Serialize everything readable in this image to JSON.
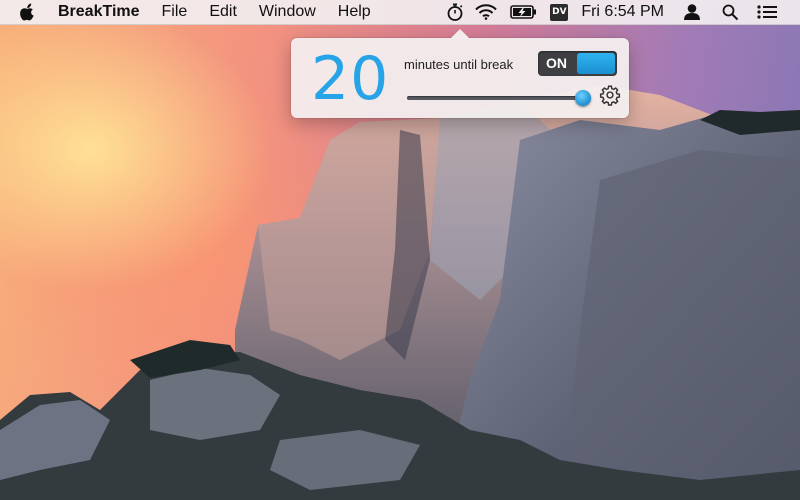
{
  "menubar": {
    "app_name": "BreakTime",
    "menus": [
      "File",
      "Edit",
      "Window",
      "Help"
    ],
    "status": {
      "icons": [
        "stopwatch-icon",
        "wifi-icon",
        "battery-charging-icon",
        "dv-app-icon",
        "user-icon",
        "spotlight-search-icon",
        "notification-center-icon"
      ],
      "dv_label": "DV",
      "clock": "Fri 6:54 PM"
    }
  },
  "popover": {
    "minutes_value": "20",
    "minutes_label": "minutes until break",
    "toggle_label": "ON",
    "toggle_state": "on",
    "slider_fraction": 1.0
  },
  "colors": {
    "accent_blue": "#27a3e8",
    "toggle_dark": "#3e3f42"
  }
}
